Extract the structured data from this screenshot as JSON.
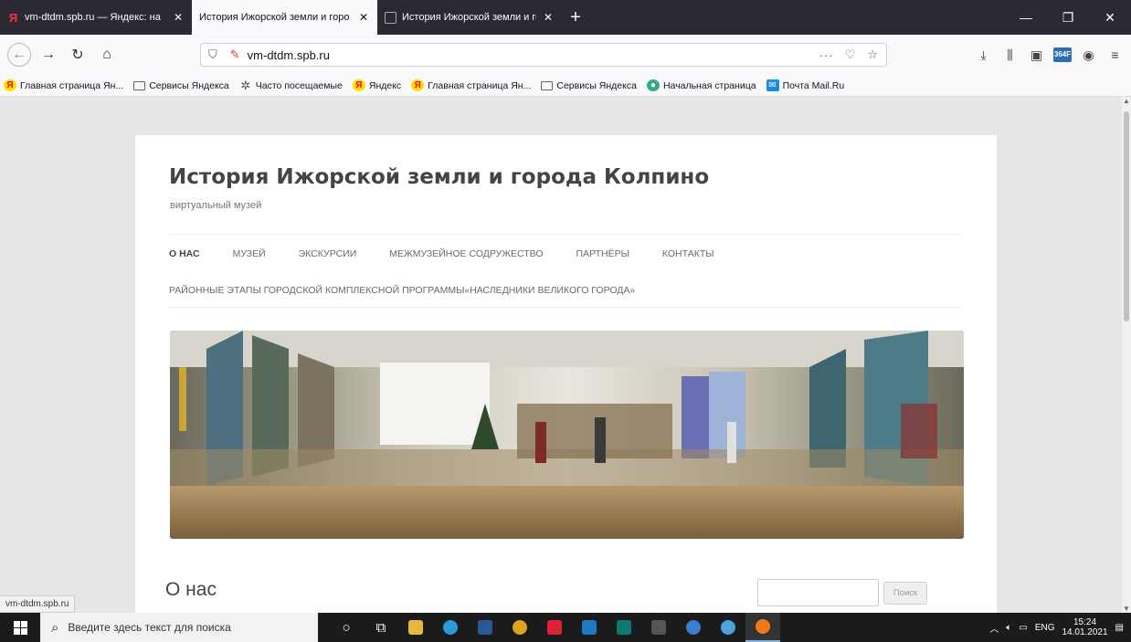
{
  "browser": {
    "tabs": [
      {
        "title": "vm-dtdm.spb.ru — Яндекс: на",
        "favicon": "yandex-icon",
        "active": false
      },
      {
        "title": "История Ижорской земли и горо",
        "favicon": "none",
        "active": true
      },
      {
        "title": "История Ижорской земли и горо",
        "favicon": "page-icon",
        "active": false
      }
    ],
    "new_tab_label": "+",
    "url": "vm-dtdm.spb.ru",
    "url_actions": "···",
    "extension_badge": "364F",
    "bookmarks": [
      {
        "label": "Главная страница Ян...",
        "icon": "yandex-icon"
      },
      {
        "label": "Сервисы Яндекса",
        "icon": "folder-icon"
      },
      {
        "label": "Часто посещаемые",
        "icon": "gear-icon"
      },
      {
        "label": "Яндекс",
        "icon": "yandex-icon"
      },
      {
        "label": "Главная страница Ян...",
        "icon": "yandex-icon"
      },
      {
        "label": "Сервисы Яндекса",
        "icon": "folder-icon"
      },
      {
        "label": "Начальная страница",
        "icon": "globe-icon"
      },
      {
        "label": "Почта Mail.Ru",
        "icon": "mail-icon"
      }
    ],
    "status_url": "vm-dtdm.spb.ru"
  },
  "site": {
    "title": "История Ижорской земли и города Колпино",
    "description": "виртуальный музей",
    "menu": [
      {
        "label": "О НАС",
        "active": true
      },
      {
        "label": "МУЗЕЙ",
        "active": false
      },
      {
        "label": "ЭКСКУРСИИ",
        "active": false
      },
      {
        "label": "МЕЖМУЗЕЙНОЕ СОДРУЖЕСТВО",
        "active": false
      },
      {
        "label": "ПАРТНЁРЫ",
        "active": false
      },
      {
        "label": "КОНТАКТЫ",
        "active": false
      }
    ],
    "menu_second_row": "РАЙОННЫЕ ЭТАПЫ ГОРОДСКОЙ КОМПЛЕКСНОЙ ПРОГРАММЫ«НАСЛЕДНИКИ ВЕЛИКОГО ГОРОДА»",
    "page_heading": "О нас",
    "search_button": "Поиск",
    "search_value": ""
  },
  "taskbar": {
    "search_placeholder": "Введите здесь текст для поиска",
    "language": "ENG",
    "time": "15:24",
    "date": "14.01.2021"
  }
}
